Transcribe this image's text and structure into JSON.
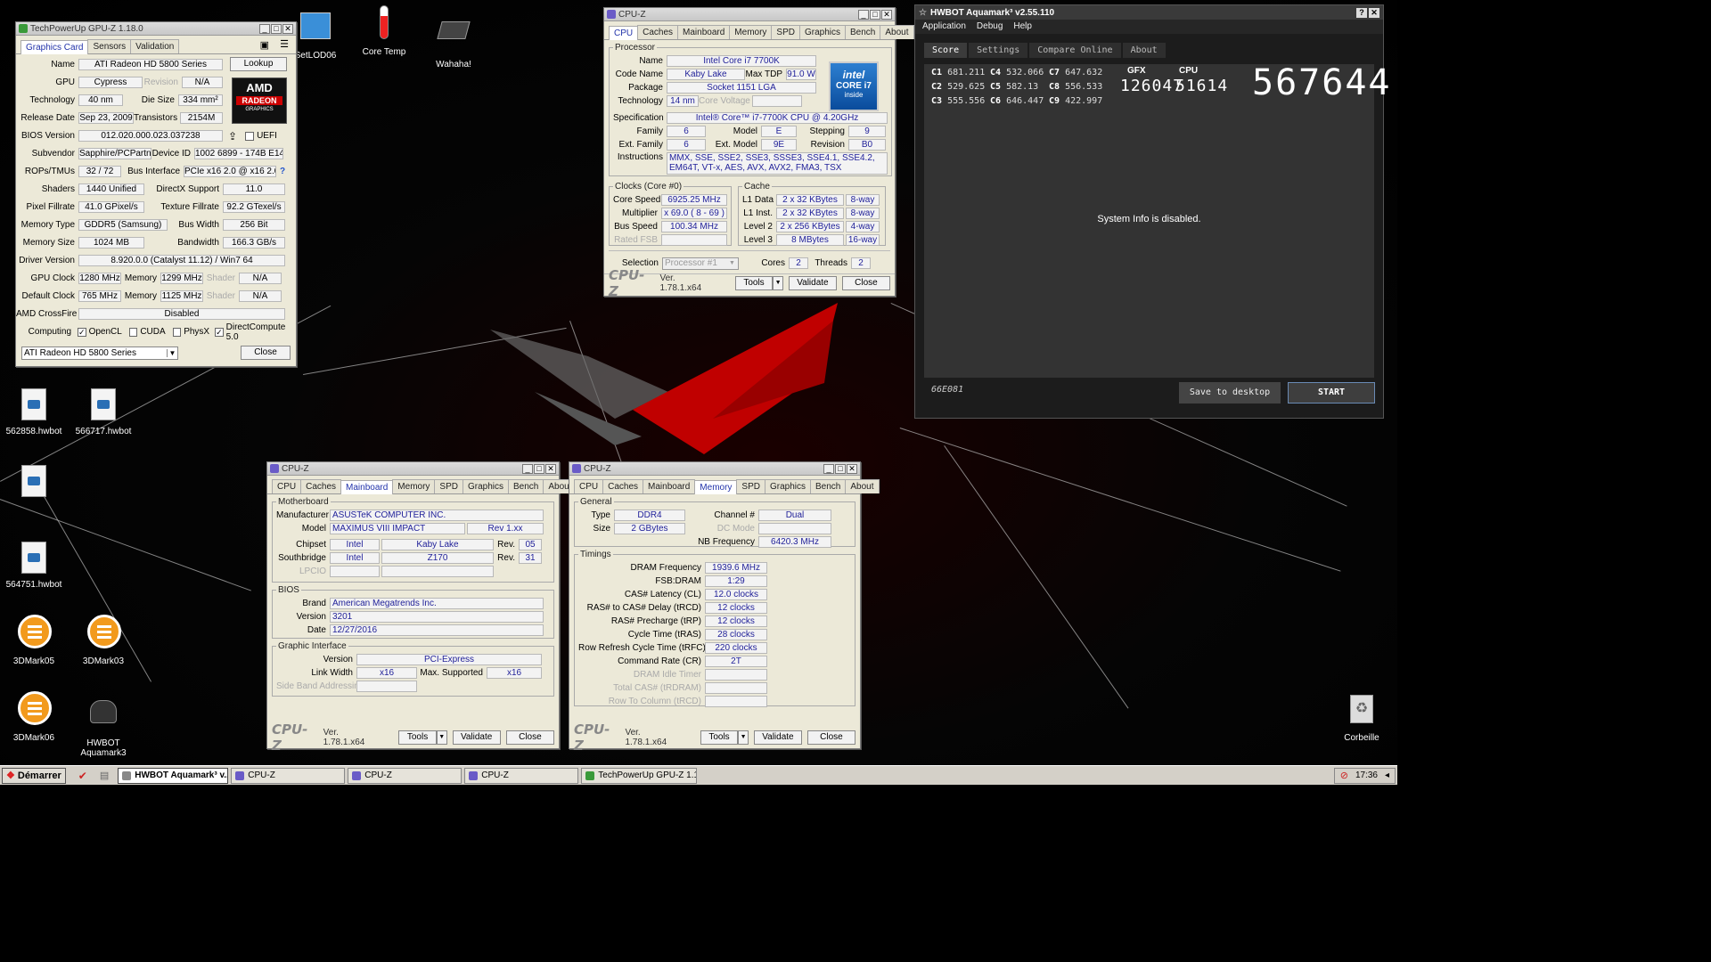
{
  "desktop": {
    "icons": [
      {
        "label": "SetLOD06"
      },
      {
        "label": "Core Temp"
      },
      {
        "label": "Wahaha!"
      },
      {
        "label": "562858.hwbot"
      },
      {
        "label": "566717.hwbot"
      },
      {
        "label": "564751.hwbot"
      },
      {
        "label": "3DMark05"
      },
      {
        "label": "3DMark03"
      },
      {
        "label": "3DMark06"
      },
      {
        "label": "HWBOT Aquamark3"
      },
      {
        "label": "Corbeille"
      }
    ]
  },
  "gpuz": {
    "title": "TechPowerUp GPU-Z 1.18.0",
    "tabs": [
      "Graphics Card",
      "Sensors",
      "Validation"
    ],
    "name_label": "Name",
    "name": "ATI Radeon HD 5800 Series",
    "lookup": "Lookup",
    "gpu_label": "GPU",
    "gpu": "Cypress",
    "revision_label": "Revision",
    "revision": "N/A",
    "logo_amd": "AMD",
    "logo_radeon": "RADEON",
    "logo_graphics": "GRAPHICS",
    "technology_label": "Technology",
    "technology": "40 nm",
    "die_size_label": "Die Size",
    "die_size": "334 mm²",
    "release_label": "Release Date",
    "release": "Sep 23, 2009",
    "transistors_label": "Transistors",
    "transistors": "2154M",
    "bios_label": "BIOS Version",
    "bios": "012.020.000.023.037238",
    "uefi_label": "UEFI",
    "subvendor_label": "Subvendor",
    "subvendor": "Sapphire/PCPartner",
    "device_id_label": "Device ID",
    "device_id": "1002 6899 - 174B E140",
    "rops_label": "ROPs/TMUs",
    "rops": "32 / 72",
    "bus_label": "Bus Interface",
    "bus": "PCIe x16 2.0 @ x16 2.0",
    "shaders_label": "Shaders",
    "shaders": "1440 Unified",
    "directx_label": "DirectX Support",
    "directx": "11.0",
    "pixel_label": "Pixel Fillrate",
    "pixel": "41.0 GPixel/s",
    "texture_label": "Texture Fillrate",
    "texture": "92.2 GTexel/s",
    "memtype_label": "Memory Type",
    "memtype": "GDDR5 (Samsung)",
    "buswidth_label": "Bus Width",
    "buswidth": "256 Bit",
    "memsize_label": "Memory Size",
    "memsize": "1024 MB",
    "bandwidth_label": "Bandwidth",
    "bandwidth": "166.3 GB/s",
    "driver_label": "Driver Version",
    "driver": "8.920.0.0 (Catalyst 11.12) / Win7 64",
    "gpuclock_label": "GPU Clock",
    "gpuclock": "1280 MHz",
    "memory_label": "Memory",
    "memclock": "1299 MHz",
    "shader_label": "Shader",
    "shader": "N/A",
    "defclock_label": "Default Clock",
    "defclock": "765 MHz",
    "defmem": "1125 MHz",
    "defshader": "N/A",
    "crossfire_label": "AMD CrossFire",
    "crossfire": "Disabled",
    "computing_label": "Computing",
    "opencl": "OpenCL",
    "cuda": "CUDA",
    "physx": "PhysX",
    "dc": "DirectCompute 5.0",
    "select": "ATI Radeon HD 5800 Series",
    "close": "Close"
  },
  "cpuz_cpu": {
    "title": "CPU-Z",
    "tabs": [
      "CPU",
      "Caches",
      "Mainboard",
      "Memory",
      "SPD",
      "Graphics",
      "Bench",
      "About"
    ],
    "processor_legend": "Processor",
    "name_label": "Name",
    "name": "Intel Core i7 7700K",
    "codename_label": "Code Name",
    "codename": "Kaby Lake",
    "tdp_label": "Max TDP",
    "tdp": "91.0 W",
    "package_label": "Package",
    "package": "Socket 1151 LGA",
    "tech_label": "Technology",
    "tech": "14 nm",
    "voltage_label": "Core Voltage",
    "logo_intel": "intel",
    "logo_core": "CORE i7",
    "logo_inside": "inside",
    "spec_label": "Specification",
    "spec": "Intel® Core™ i7-7700K CPU @ 4.20GHz",
    "family_label": "Family",
    "family": "6",
    "model_label": "Model",
    "model": "E",
    "stepping_label": "Stepping",
    "stepping": "9",
    "extfamily_label": "Ext. Family",
    "extfamily": "6",
    "extmodel_label": "Ext. Model",
    "extmodel": "9E",
    "revision_label": "Revision",
    "revision": "B0",
    "instr_label": "Instructions",
    "instr": "MMX, SSE, SSE2, SSE3, SSSE3, SSE4.1, SSE4.2, EM64T, VT-x, AES, AVX, AVX2, FMA3, TSX",
    "clocks_legend": "Clocks (Core #0)",
    "corespeed_label": "Core Speed",
    "corespeed": "6925.25 MHz",
    "multiplier_label": "Multiplier",
    "multiplier": "x 69.0 ( 8 - 69 )",
    "busspeed_label": "Bus Speed",
    "busspeed": "100.34 MHz",
    "ratedfsb_label": "Rated FSB",
    "cache_legend": "Cache",
    "l1d_label": "L1 Data",
    "l1d": "2 x 32 KBytes",
    "l1d_way": "8-way",
    "l1i_label": "L1 Inst.",
    "l1i": "2 x 32 KBytes",
    "l1i_way": "8-way",
    "l2_label": "Level 2",
    "l2": "2 x 256 KBytes",
    "l2_way": "4-way",
    "l3_label": "Level 3",
    "l3": "8 MBytes",
    "l3_way": "16-way",
    "selection_label": "Selection",
    "selection": "Processor #1",
    "cores_label": "Cores",
    "cores": "2",
    "threads_label": "Threads",
    "threads": "2",
    "logo": "CPU-Z",
    "version": "Ver. 1.78.1.x64",
    "tools": "Tools",
    "validate": "Validate",
    "close": "Close"
  },
  "cpuz_mb": {
    "title": "CPU-Z",
    "mb_legend": "Motherboard",
    "manufacturer_label": "Manufacturer",
    "manufacturer": "ASUSTeK COMPUTER INC.",
    "model_label": "Model",
    "model": "MAXIMUS VIII IMPACT",
    "model_rev": "Rev 1.xx",
    "chipset_label": "Chipset",
    "chipset_vendor": "Intel",
    "chipset": "Kaby Lake",
    "rev_label": "Rev.",
    "chipset_rev": "05",
    "south_label": "Southbridge",
    "south_vendor": "Intel",
    "south": "Z170",
    "south_rev": "31",
    "lpcio_label": "LPCIO",
    "bios_legend": "BIOS",
    "brand_label": "Brand",
    "brand": "American Megatrends Inc.",
    "version_label": "Version",
    "version": "3201",
    "date_label": "Date",
    "date": "12/27/2016",
    "gi_legend": "Graphic Interface",
    "gi_version_label": "Version",
    "gi_version": "PCI-Express",
    "linkwidth_label": "Link Width",
    "linkwidth": "x16",
    "maxsup_label": "Max. Supported",
    "maxsup": "x16",
    "sideband_label": "Side Band Addressing"
  },
  "cpuz_mem": {
    "title": "CPU-Z",
    "general_legend": "General",
    "type_label": "Type",
    "type": "DDR4",
    "channel_label": "Channel #",
    "channel": "Dual",
    "size_label": "Size",
    "size": "2 GBytes",
    "dcmode_label": "DC Mode",
    "nbfreq_label": "NB Frequency",
    "nbfreq": "6420.3 MHz",
    "timings_legend": "Timings",
    "timings": [
      {
        "label": "DRAM Frequency",
        "value": "1939.6 MHz"
      },
      {
        "label": "FSB:DRAM",
        "value": "1:29"
      },
      {
        "label": "CAS# Latency (CL)",
        "value": "12.0 clocks"
      },
      {
        "label": "RAS# to CAS# Delay (tRCD)",
        "value": "12 clocks"
      },
      {
        "label": "RAS# Precharge (tRP)",
        "value": "12 clocks"
      },
      {
        "label": "Cycle Time (tRAS)",
        "value": "28 clocks"
      },
      {
        "label": "Row Refresh Cycle Time (tRFC)",
        "value": "220 clocks"
      },
      {
        "label": "Command Rate (CR)",
        "value": "2T"
      },
      {
        "label": "DRAM Idle Timer",
        "value": ""
      },
      {
        "label": "Total CAS# (tRDRAM)",
        "value": ""
      },
      {
        "label": "Row To Column (tRCD)",
        "value": ""
      }
    ]
  },
  "aquamark": {
    "title": "HWBOT Aquamark³ v2.55.110",
    "menu": [
      "Application",
      "Debug",
      "Help"
    ],
    "tabs": [
      "Score",
      "Settings",
      "Compare Online",
      "About"
    ],
    "scores": [
      {
        "k": "C1",
        "v": "681.211"
      },
      {
        "k": "C4",
        "v": "532.066"
      },
      {
        "k": "C7",
        "v": "647.632"
      },
      {
        "k": "C2",
        "v": "529.625"
      },
      {
        "k": "C5",
        "v": "582.13"
      },
      {
        "k": "C8",
        "v": "556.533"
      },
      {
        "k": "C3",
        "v": "555.556"
      },
      {
        "k": "C6",
        "v": "646.447"
      },
      {
        "k": "C9",
        "v": "422.997"
      }
    ],
    "gfx_label": "GFX",
    "gfx": "126047",
    "cpu_label": "CPU",
    "cpu": "51614",
    "total": "567644",
    "sysinfo": "System Info is disabled.",
    "code": "66E081",
    "save": "Save to desktop",
    "start": "START"
  },
  "taskbar": {
    "start": "Démarrer",
    "items": [
      "HWBOT Aquamark³ v...",
      "CPU-Z",
      "CPU-Z",
      "CPU-Z",
      "TechPowerUp GPU-Z 1.1..."
    ],
    "clock": "17:36"
  }
}
